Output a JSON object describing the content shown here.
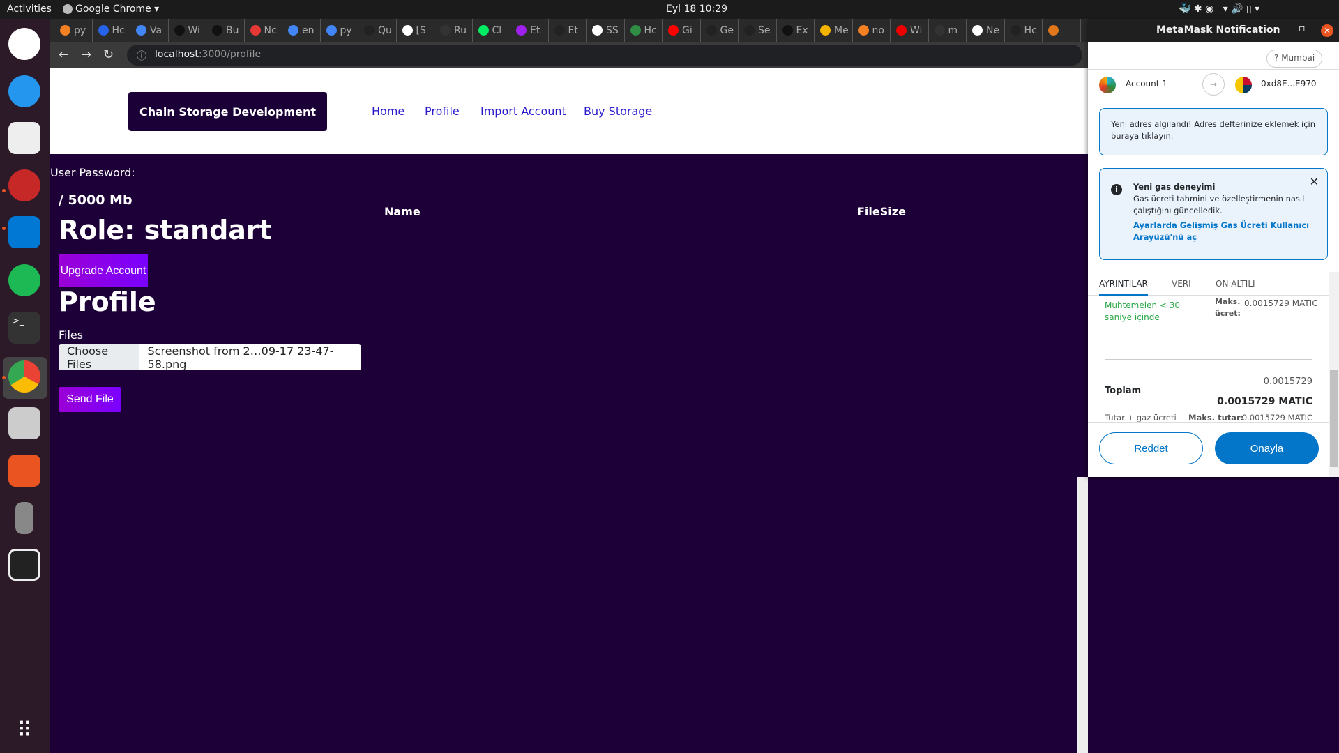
{
  "system": {
    "activities": "Activities",
    "app": "Google Chrome ▾",
    "clock": "Eyl 18  10:29"
  },
  "browser": {
    "tabs": [
      "py",
      "Hc",
      "Va",
      "Wi",
      "Bu",
      "Nc",
      "en",
      "py",
      "Qu",
      "[S",
      "Ru",
      "Cl",
      "Et",
      "Et",
      "SS",
      "Hc",
      "Gi",
      "Ge",
      "Se",
      "Ex",
      "Me",
      "no",
      "Wi",
      "m",
      "Ne",
      "Hc",
      ""
    ],
    "tab_colors": [
      "#f48024",
      "#2563eb",
      "#4285f4",
      "#111",
      "#111",
      "#e53935",
      "#4285f4",
      "#4285f4",
      "#222",
      "#fff",
      "#333",
      "#00ed64",
      "#a020f0",
      "#222",
      "#fff",
      "#2f8d46",
      "#ff0000",
      "#222",
      "#222",
      "#111",
      "#f4b400",
      "#f48024",
      "#e00",
      "#333",
      "#fff",
      "#222",
      "#e2761b"
    ],
    "url_host": "localhost",
    "url_path": ":3000/profile"
  },
  "site": {
    "brand": "Chain Storage Development",
    "nav": [
      "Home",
      "Profile",
      "Import Account",
      "Buy Storage"
    ],
    "user_password_label": "User Password:",
    "storage": "/ 5000 Mb",
    "role": "Role: standart",
    "upgrade_button": "Upgrade Account",
    "profile_title": "Profile",
    "files_label": "Files",
    "choose_files": "Choose Files",
    "file_name": "Screenshot from 2…09-17 23-47-58.png",
    "send_button": "Send File",
    "table_headers": [
      "Name",
      "FileSize"
    ]
  },
  "metamask": {
    "title": "MetaMask Notification",
    "network": "Mumbai",
    "from_account": "Account 1",
    "to_account": "0xd8E...E970",
    "new_address_notice": "Yeni adres algılandı! Adres defterinize eklemek için buraya tıklayın.",
    "gas_title": "Yeni gas deneyimi",
    "gas_text": "Gas ücreti tahmini ve özelleştirmenin nasıl çalıştığını güncelledik.",
    "gas_link": "Ayarlarda Gelişmiş Gas Ücreti Kullanıcı Arayüzü'nü aç",
    "tabs": [
      "AYRINTILAR",
      "VERI",
      "ON ALTILI"
    ],
    "eta": "Muhtemelen < 30 saniye içinde",
    "max_fee_label": "Maks. ücret:",
    "max_fee": "0.0015729 MATIC",
    "total_label": "Toplam",
    "total_small": "0.0015729",
    "total": "0.0015729 MATIC",
    "amount_gas_label": "Tutar + gaz ücreti",
    "max_amount_label": "Maks. tutar:",
    "max_amount": "0.0015729 MATIC",
    "reject": "Reddet",
    "confirm": "Onayla",
    "accent": "#0376c9"
  }
}
